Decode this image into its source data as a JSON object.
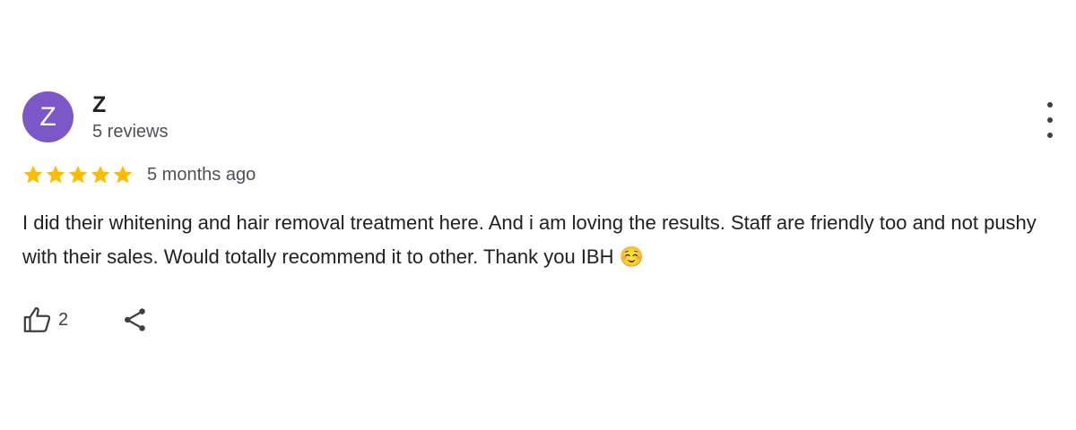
{
  "reviewer": {
    "avatar_letter": "Z",
    "avatar_color": "#7b57c8",
    "name": "Z",
    "review_count": "5 reviews"
  },
  "review": {
    "rating": 5,
    "max_rating": 5,
    "star_color": "#fbbc04",
    "time_ago": "5 months ago",
    "text": "I did their whitening and hair removal treatment here. And i am loving the results. Staff are friendly too and not pushy with their sales. Would totally recommend it to other. Thank you IBH ☺️"
  },
  "actions": {
    "like_icon": "thumbs-up-icon",
    "like_count": "2",
    "share_icon": "share-icon",
    "more_icon": "more-vert-icon"
  }
}
